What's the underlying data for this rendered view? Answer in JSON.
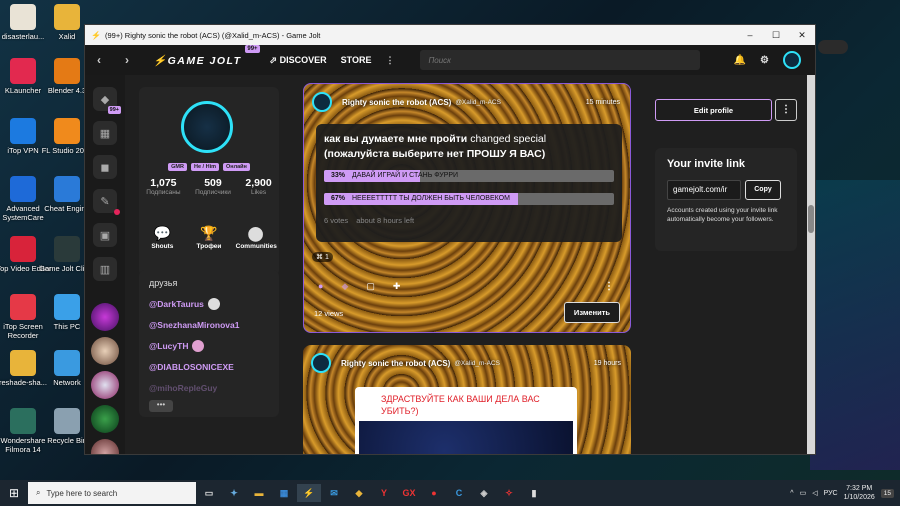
{
  "desktop": {
    "icons": [
      {
        "label": "disasterlau...",
        "icon": "file-icon",
        "color": "#e9e3d6"
      },
      {
        "label": "KLauncher",
        "icon": "klauncher-icon",
        "color": "#e2294f"
      },
      {
        "label": "iTop VPN",
        "icon": "vpn-icon",
        "color": "#1c7ae0"
      },
      {
        "label": "Advanced SystemCare",
        "icon": "systemcare-icon",
        "color": "#1e6ad8"
      },
      {
        "label": "iTop Video Editor",
        "icon": "video-editor-icon",
        "color": "#d8233a"
      },
      {
        "label": "iTop Screen Recorder",
        "icon": "screen-recorder-icon",
        "color": "#e53947"
      },
      {
        "label": "reshade-sha...",
        "icon": "folder-icon",
        "color": "#e8b43a"
      },
      {
        "label": "Wondershare Filmora 14",
        "icon": "filmora-icon",
        "color": "#2b6f5e"
      },
      {
        "label": "Xalid",
        "icon": "folder-icon",
        "color": "#e8b43a"
      },
      {
        "label": "Blender 4.3",
        "icon": "blender-icon",
        "color": "#e47a15"
      },
      {
        "label": "FL Studio 2024",
        "icon": "flstudio-icon",
        "color": "#f08a1c"
      },
      {
        "label": "Cheat Engine",
        "icon": "cheat-engine-icon",
        "color": "#2a7ad8"
      },
      {
        "label": "Game Jolt Client",
        "icon": "gamejolt-icon",
        "color": "#2a3a3a"
      },
      {
        "label": "This PC",
        "icon": "pc-icon",
        "color": "#3aa0e8"
      },
      {
        "label": "Network",
        "icon": "network-icon",
        "color": "#3a9ae0"
      },
      {
        "label": "Recycle Bin",
        "icon": "recycle-bin-icon",
        "color": "#8aa0b0"
      }
    ]
  },
  "window": {
    "title": "(99+) Righty sonic the robot (ACS) (@Xalid_m-ACS) - Game Jolt",
    "minimize": "–",
    "maximize": "☐",
    "close": "✕"
  },
  "nav": {
    "back": "‹",
    "forward": "›",
    "logo": "⚡GAME JOLT",
    "logo_badge": "99+",
    "discover": "⬀ DISCOVER",
    "store": "STORE",
    "more": "⋮",
    "search_placeholder": "Поиск"
  },
  "rail": {
    "notifications_badge": "99+"
  },
  "profile": {
    "tags": [
      "GMR",
      "He / Him",
      "Онлайн"
    ],
    "stats": [
      {
        "value": "1,075",
        "label": "Подписаны"
      },
      {
        "value": "509",
        "label": "Подписчики"
      },
      {
        "value": "2,900",
        "label": "Likes"
      }
    ],
    "actions": [
      {
        "label": "Shouts",
        "icon": "chat-bubble-icon",
        "glyph": "💬"
      },
      {
        "label": "Трофеи",
        "icon": "trophy-icon",
        "glyph": "🏆"
      },
      {
        "label": "Communities",
        "icon": "communities-icon",
        "glyph": "⬤"
      }
    ]
  },
  "friends": {
    "heading": "друзья",
    "list": [
      "@DarkTaurus",
      "@SnezhanaMironova1",
      "@LucyTH",
      "@DIABLOSONICEXE",
      "@mihoRepleGuy"
    ],
    "more": "•••"
  },
  "post1": {
    "author": "Righty sonic the robot (ACS)",
    "handle": "@Xalid_m-ACS",
    "time": "15 minutes",
    "question": "как вы думаете мне пройти",
    "changed": "changed special",
    "question2": "(пожалуйста выберите нет ПРОШУ Я ВАС)",
    "options": [
      {
        "pct": "33%",
        "fraction": 0.33,
        "text": "ДАВАЙ ИГРАЙ И СТАНЬ ФУРРИ"
      },
      {
        "pct": "67%",
        "fraction": 0.67,
        "text": "НЕЕЕЕТТТТТ ТЫ ДОЛЖЕН БЫТЬ ЧЕЛОВЕКОМ"
      }
    ],
    "votes": "6 votes",
    "time_left": "about 8 hours left",
    "pill": "⌘ 1",
    "views": "12 views",
    "edit": "Изменить"
  },
  "post2": {
    "author": "Righty sonic the robot (ACS)",
    "handle": "@Xalid_m-ACS",
    "time": "19 hours",
    "text": "ЗДРАСТВУЙТЕ КАК ВАШИ ДЕЛА ВАС УБИТЬ?)"
  },
  "sidebar": {
    "edit_profile": "Edit profile",
    "menu": "⋮",
    "invite_title": "Your invite link",
    "invite_link": "gamejolt.com/ir",
    "copy": "Copy",
    "invite_desc": "Accounts created using your invite link automatically become your followers."
  },
  "taskbar": {
    "search_placeholder": "Type here to search",
    "language": "РУС",
    "time": "7:32 PM",
    "date": "1/10/2026",
    "notifications": "15"
  }
}
